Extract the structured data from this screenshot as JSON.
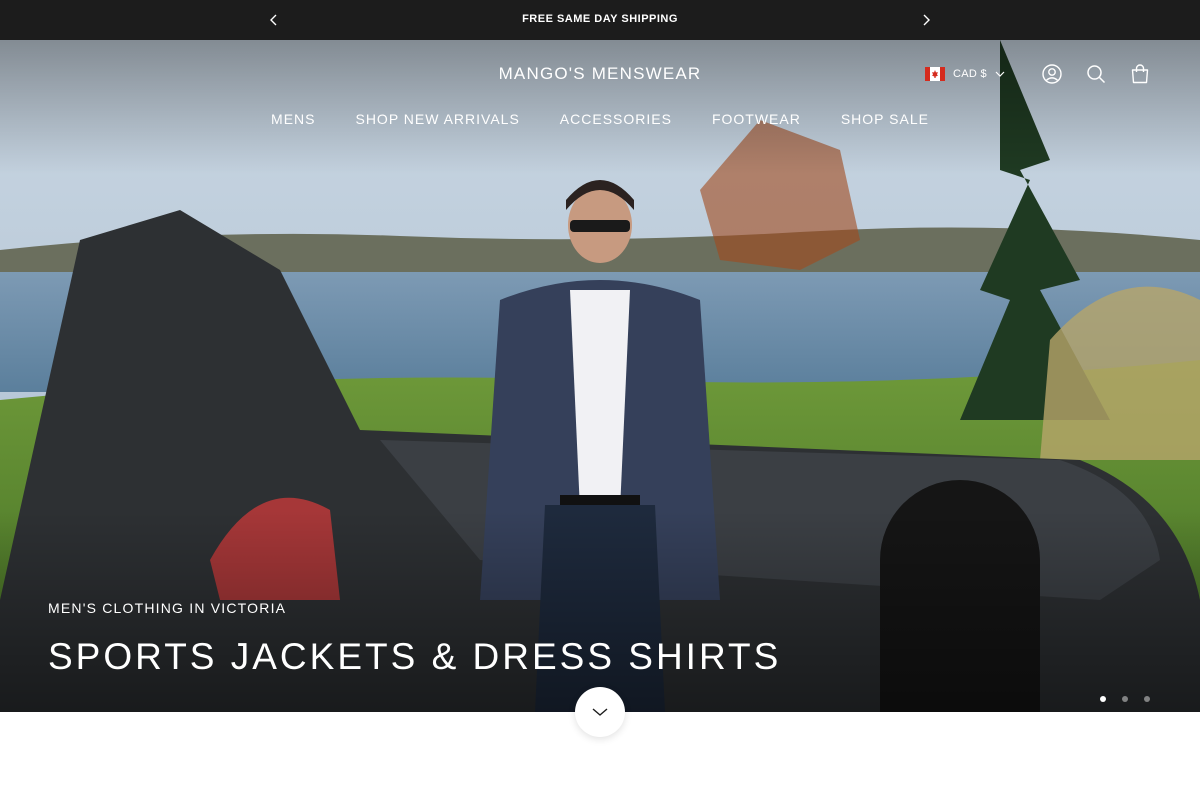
{
  "announcement": {
    "message": "FREE SAME DAY SHIPPING",
    "prev_icon": "chevron-left-icon",
    "next_icon": "chevron-right-icon"
  },
  "header": {
    "logo": "MANGO'S MENSWEAR",
    "locale": {
      "flag_icon": "canada-flag-icon",
      "currency": "CAD $",
      "chevron_icon": "chevron-down-icon"
    },
    "icons": [
      "account-icon",
      "search-icon",
      "cart-icon"
    ]
  },
  "nav": {
    "items": [
      {
        "label": "MENS"
      },
      {
        "label": "SHOP NEW ARRIVALS"
      },
      {
        "label": "ACCESSORIES"
      },
      {
        "label": "FOOTWEAR"
      },
      {
        "label": "SHOP SALE"
      }
    ]
  },
  "hero": {
    "eyebrow": "MEN'S CLOTHING IN VICTORIA",
    "headline": "SPORTS JACKETS & DRESS SHIRTS",
    "slides": {
      "total": 3,
      "active": 1
    },
    "scroll_icon": "chevron-down-icon"
  },
  "colors": {
    "announcement_bg": "#1c1c1c",
    "text_on_hero": "#ffffff",
    "page_bg": "#ffffff"
  }
}
